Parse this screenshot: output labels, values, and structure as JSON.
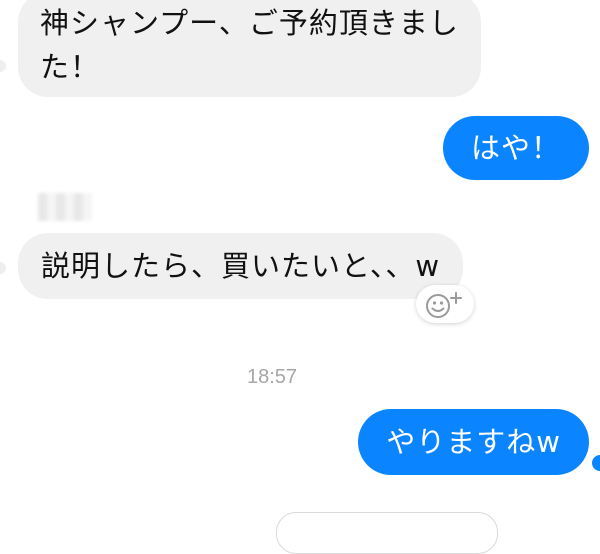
{
  "conversation": {
    "messages": [
      {
        "direction": "incoming",
        "text": "神シャンプー、ご予約頂きました！"
      },
      {
        "direction": "outgoing",
        "text": "はや！"
      },
      {
        "direction": "incoming",
        "text": "説明したら、買いたいと、、w"
      },
      {
        "direction": "outgoing",
        "text": "やりますねw"
      }
    ],
    "timestamp": "18:57",
    "reaction_button_icon": "smiley-plus-icon"
  },
  "colors": {
    "outgoing_bubble": "#0a84ff",
    "incoming_bubble": "#f0f0f0",
    "timestamp_text": "#a6a6a6"
  }
}
